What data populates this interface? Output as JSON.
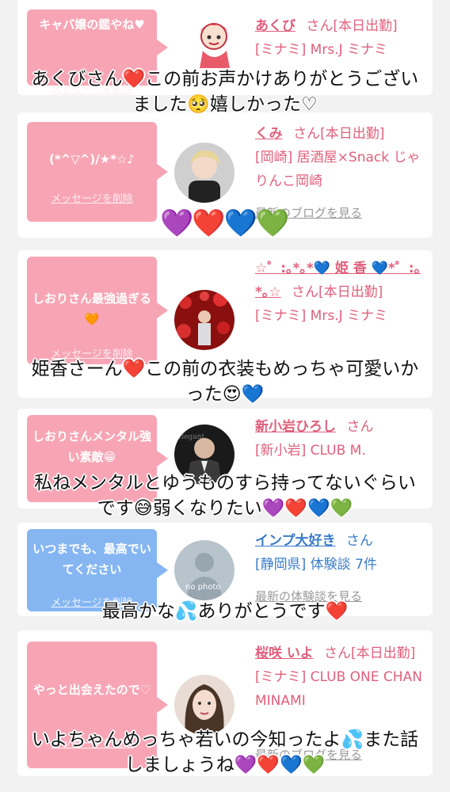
{
  "delete_label": "メッセージを削除",
  "cards": [
    {
      "message": "キャバ嬢の鑑やね♥",
      "name": "あくび",
      "suffix": "さん[本日出勤]",
      "shop": "[ミナミ] Mrs.J ミナミ",
      "link": "最新のブログを見る"
    },
    {
      "message": "(*^▽^)/★*☆♪",
      "name": "くみ",
      "suffix": "さん[本日出勤]",
      "shop": "[岡崎] 居酒屋×Snack じゃりんこ岡崎",
      "link": "最新のブログを見る"
    },
    {
      "message": "しおりさん最強過ぎる🧡",
      "name": "☆゜:｡*｡*💙 姫 香 💙*゜:｡*｡☆",
      "suffix": "さん[本日出勤]",
      "shop": "[ミナミ] Mrs.J ミナミ",
      "link": "最新のブログを見る"
    },
    {
      "message": "しおりさんメンタル強い素敵😁",
      "name": "新小岩ひろし",
      "suffix": "さん",
      "shop": "[新小岩] CLUB M.",
      "link": "最新のブログを見る"
    },
    {
      "message": "いつまでも、最高でいてください",
      "name": "インプ大好き",
      "suffix": "さん",
      "shop": "[静岡県] 体験談 7件",
      "link": "最新の体験談を見る",
      "avatar_text": "no photo"
    },
    {
      "message": "やっと出会えたので♡",
      "name": "桜咲 いよ",
      "suffix": "さん[本日出勤]",
      "shop": "[ミナミ] CLUB ONE CHAN MINAMI",
      "link": "最新のブログを見る"
    }
  ],
  "captions": {
    "c1_l1": "あくびさん❤️この前お声かけありがとうござい",
    "c1_l2": "ました🥺嬉しかった♡",
    "c2": "💜❤️💙💚",
    "c3_l1": "姫香さーん❤️この前の衣装もめっちゃ可愛いか",
    "c3_l2": "った😍💙",
    "c4_l1": "私ねメンタルとゆうものすら持ってないぐらい",
    "c4_l2": "です😅弱くなりたい💜❤️💙💚",
    "c5": "最高かな💦ありがとうです❤️",
    "c6_l1": "いよちゃんめっちゃ若いの今知ったよ💦また話",
    "c6_l2": "しましょうね💜❤️💙💚"
  }
}
